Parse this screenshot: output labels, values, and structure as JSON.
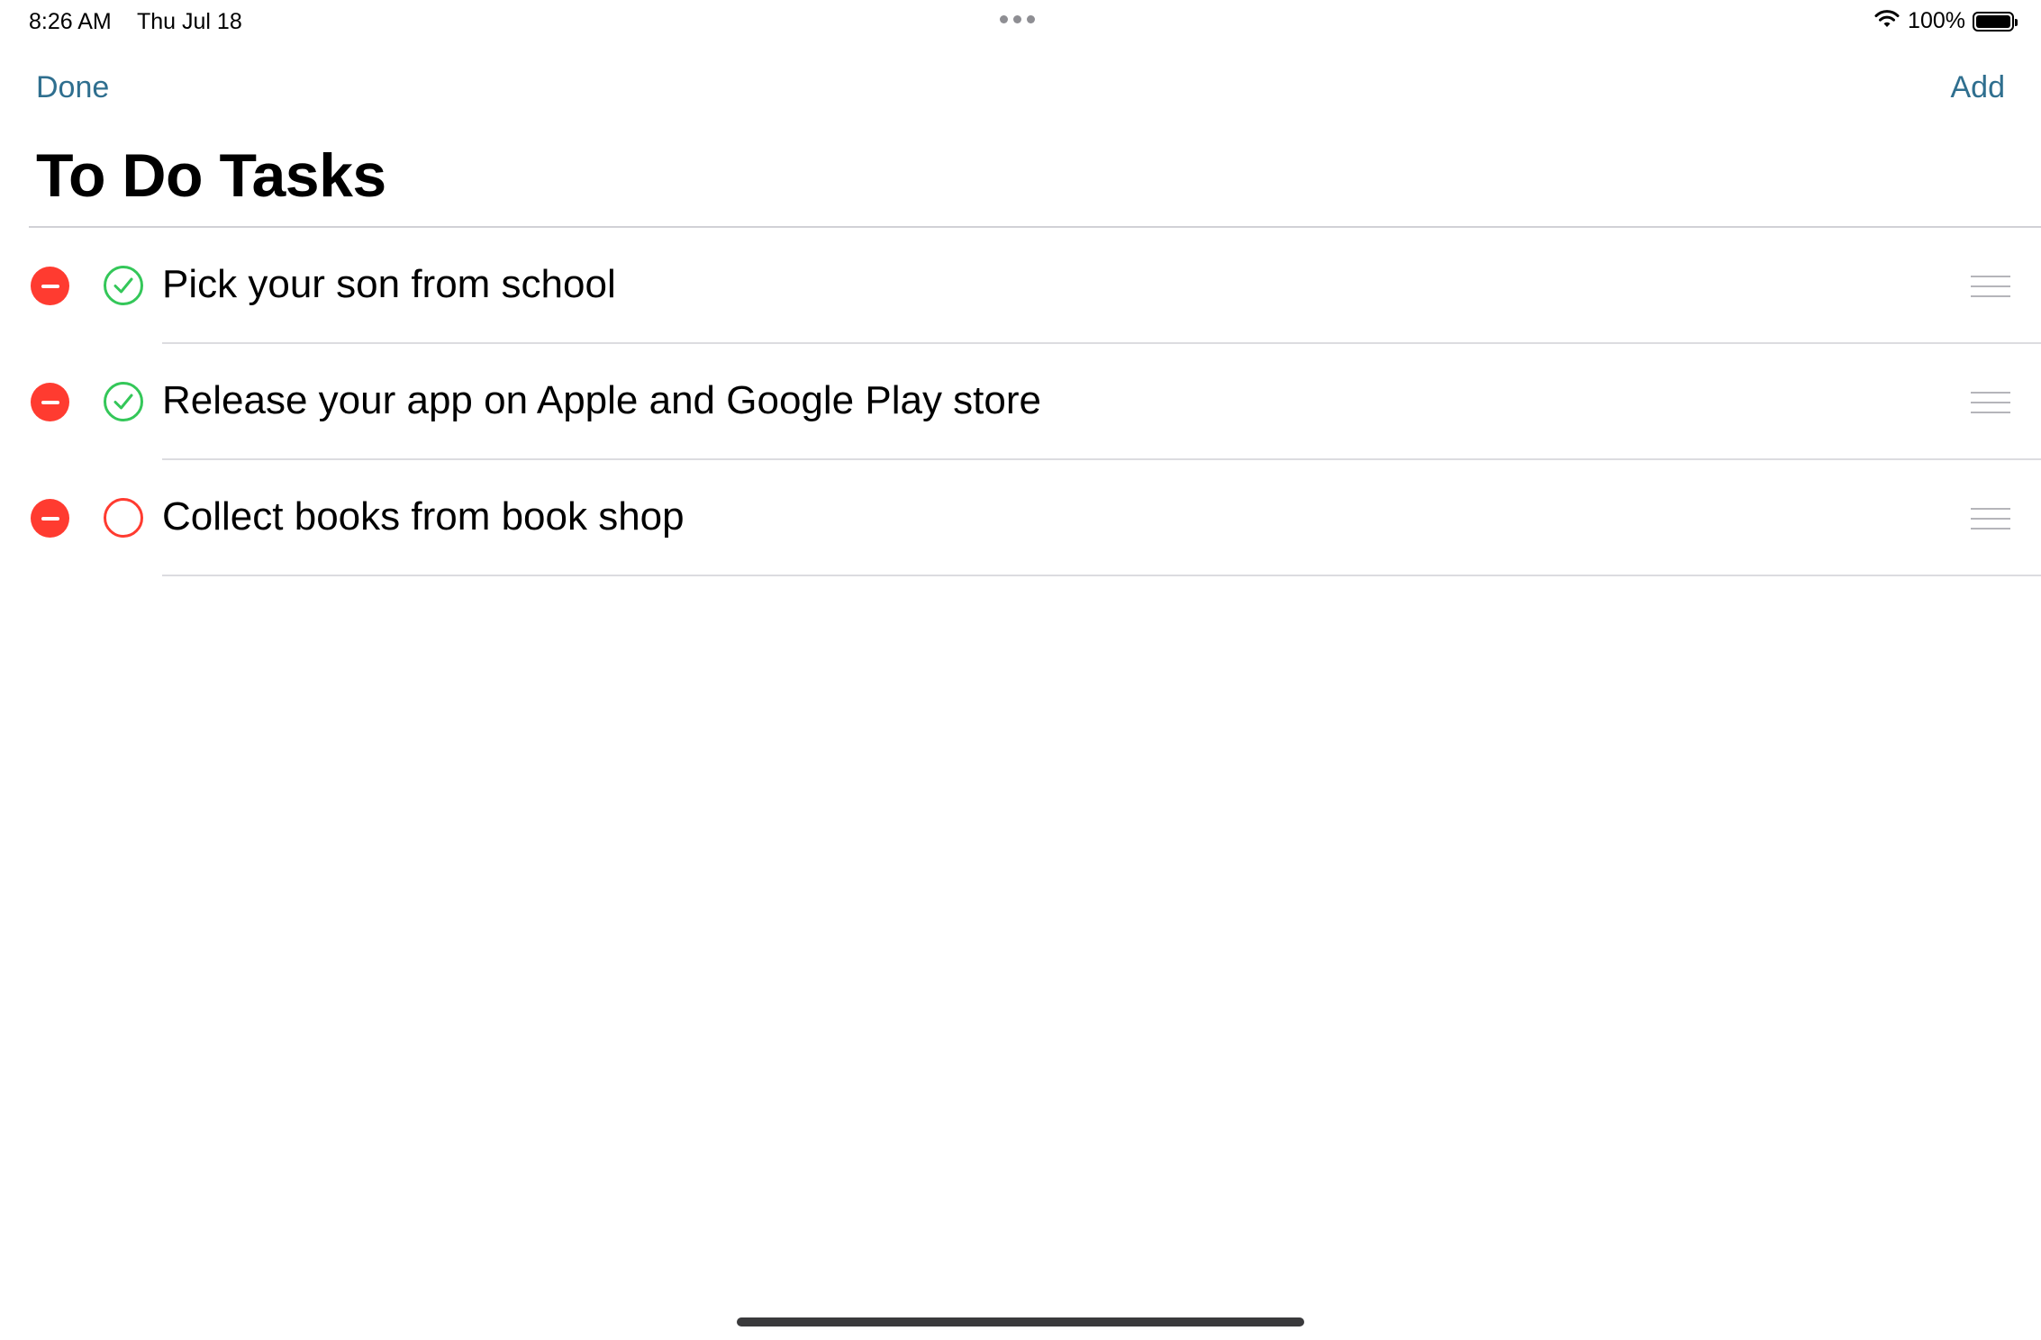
{
  "status_bar": {
    "time": "8:26 AM",
    "date": "Thu Jul 18",
    "battery_percent": "100%",
    "battery_level": 1.0,
    "icons": [
      "multitasking-dots-icon",
      "wifi-icon",
      "battery-icon"
    ]
  },
  "nav": {
    "done_label": "Done",
    "add_label": "Add"
  },
  "page": {
    "title": "To Do Tasks"
  },
  "tasks": [
    {
      "label": "Pick your son from school",
      "completed": true
    },
    {
      "label": "Release your app on Apple and Google Play store",
      "completed": true
    },
    {
      "label": "Collect books from book shop",
      "completed": false
    }
  ],
  "colors": {
    "accent": "#2f6f8f",
    "delete": "#ff3b30",
    "complete": "#34c759",
    "incomplete": "#ff3b30"
  }
}
